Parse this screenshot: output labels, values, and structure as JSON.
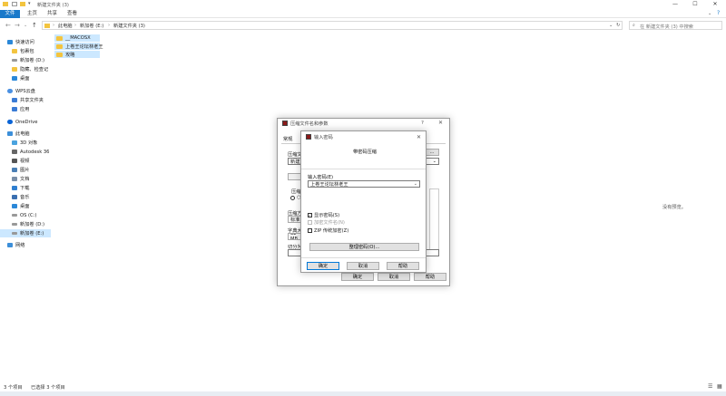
{
  "window": {
    "title": "新建文件夹 (3)",
    "controls": {
      "minimize": "—",
      "maximize": "☐",
      "close": "✕"
    }
  },
  "ribbon": {
    "tabs": [
      "文件",
      "主页",
      "共享",
      "查看"
    ]
  },
  "address": {
    "crumbs": [
      "此电脑",
      "新加卷 (E:)",
      "新建文件夹 (3)"
    ],
    "search_placeholder": "在 新建文件夹 (3) 中搜索"
  },
  "nav": {
    "items": [
      {
        "label": "快速访问",
        "icon": "star-icon"
      },
      {
        "label": "包裹包",
        "icon": "folder-icon"
      },
      {
        "label": "新加卷 (D:)",
        "icon": "drive-icon"
      },
      {
        "label": "隐藏、检查记",
        "icon": "folder-icon"
      },
      {
        "label": "桌面",
        "icon": "desktop-icon"
      },
      {
        "label": "WPS云盘",
        "icon": "cloud-icon"
      },
      {
        "label": "共享文件夹",
        "icon": "shared-icon"
      },
      {
        "label": "应用",
        "icon": "apps-icon"
      },
      {
        "label": "OneDrive",
        "icon": "onedrive-icon"
      },
      {
        "label": "此电脑",
        "icon": "pc-icon"
      },
      {
        "label": "3D 对象",
        "icon": "cube-icon"
      },
      {
        "label": "Autodesk 36",
        "icon": "autodesk-icon"
      },
      {
        "label": "视频",
        "icon": "video-icon"
      },
      {
        "label": "图片",
        "icon": "picture-icon"
      },
      {
        "label": "文档",
        "icon": "document-icon"
      },
      {
        "label": "下载",
        "icon": "download-icon"
      },
      {
        "label": "音乐",
        "icon": "music-icon"
      },
      {
        "label": "桌面",
        "icon": "desktop-icon"
      },
      {
        "label": "OS (C:)",
        "icon": "drive-icon"
      },
      {
        "label": "新加卷 (D:)",
        "icon": "drive-icon"
      },
      {
        "label": "新加卷 (E:)",
        "icon": "drive-icon"
      },
      {
        "label": "网络",
        "icon": "network-icon"
      }
    ]
  },
  "files": [
    "__MACOSX",
    "上卷王论坛林老王",
    "攻略"
  ],
  "preview_note": "没有预览。",
  "status": {
    "count": "3 个项目",
    "selected": "已选择 3 个项目"
  },
  "archive_dialog": {
    "title": "压缩文件名和参数",
    "tab": "常规",
    "labels": {
      "name": "压缩文",
      "update": "压缩",
      "method": "压缩方",
      "dict": "字典大",
      "split": "切分为"
    },
    "name_value": "新建文",
    "method_value": "标准",
    "dict_value": "32 MB",
    "buttons": {
      "ok": "确定",
      "cancel": "取消",
      "help": "帮助"
    }
  },
  "password_dialog": {
    "title": "输入密码",
    "heading": "带密码压缩",
    "prompt": "输入密码(E)",
    "value": "上卷王论坛林老王",
    "checkboxes": [
      {
        "label": "显示密码(S)",
        "checked": true,
        "disabled": false
      },
      {
        "label": "加密文件名(N)",
        "checked": false,
        "disabled": true
      },
      {
        "label": "ZIP 传统加密(Z)",
        "checked": false,
        "disabled": false
      }
    ],
    "manage_button": "整理密码(O)...",
    "buttons": {
      "ok": "确定",
      "cancel": "取消",
      "help": "帮助"
    }
  }
}
